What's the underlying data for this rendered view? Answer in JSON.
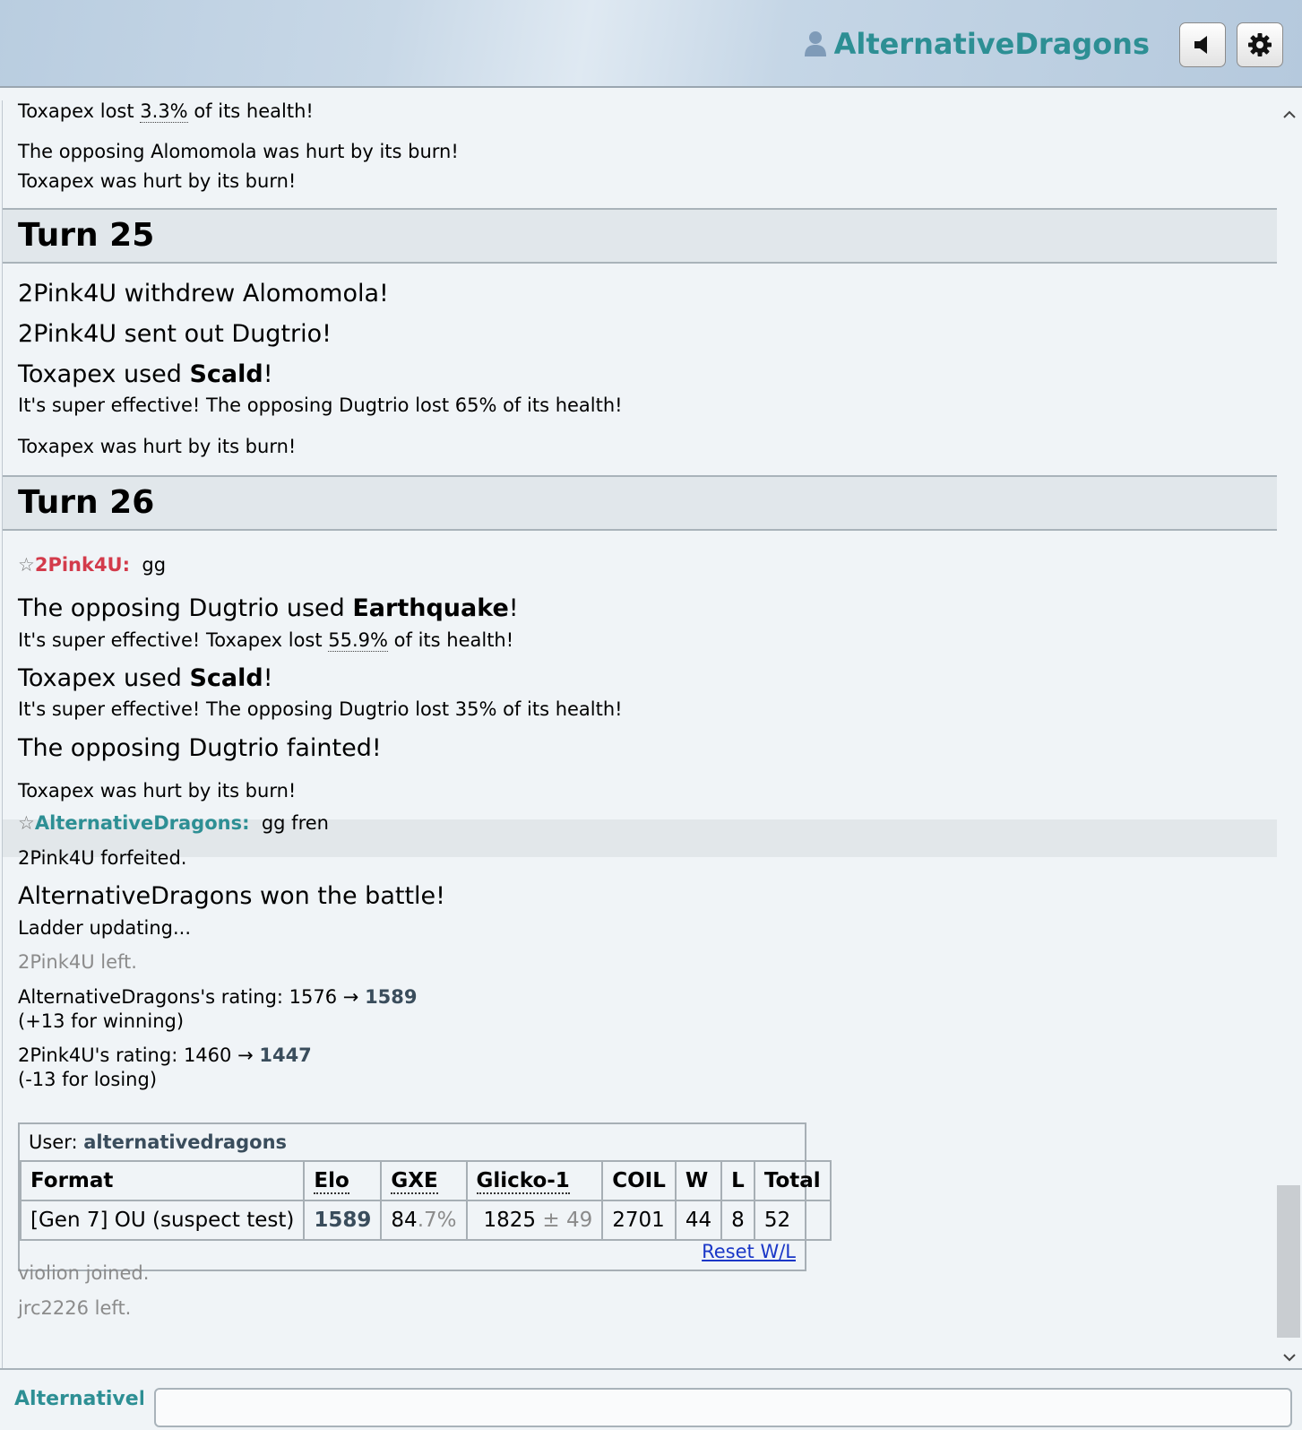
{
  "header": {
    "username": "AlternativeDragons",
    "sound_icon": "speaker-icon",
    "settings_icon": "gear-icon"
  },
  "log": {
    "top": {
      "l1_pre": "Toxapex lost ",
      "l1_pct": "3.3%",
      "l1_post": " of its health!",
      "l2": "The opposing Alomomola was hurt by its burn!",
      "l3": "Toxapex was hurt by its burn!"
    },
    "turn25": {
      "title": "Turn 25",
      "l1": "2Pink4U withdrew Alomomola!",
      "l2": "2Pink4U sent out Dugtrio!",
      "l3_pre": "Toxapex used ",
      "l3_move": "Scald",
      "l3_post": "!",
      "l4": "It's super effective! The opposing Dugtrio lost 65% of its health!",
      "l5": "Toxapex was hurt by its burn!"
    },
    "turn26": {
      "title": "Turn 26",
      "chat1_star": "☆",
      "chat1_name": "2Pink4U:",
      "chat1_msg": "gg",
      "l1_pre": "The opposing Dugtrio used ",
      "l1_move": "Earthquake",
      "l1_post": "!",
      "l2_pre": "It's super effective! Toxapex lost ",
      "l2_pct": "55.9%",
      "l2_post": " of its health!",
      "l3_pre": "Toxapex used ",
      "l3_move": "Scald",
      "l3_post": "!",
      "l4": "It's super effective! The opposing Dugtrio lost 35% of its health!",
      "l5": "The opposing Dugtrio fainted!",
      "l6": "Toxapex was hurt by its burn!",
      "chat2_star": "☆",
      "chat2_name": "AlternativeDragons:",
      "chat2_msg": "gg fren",
      "l7": "2Pink4U forfeited.",
      "l8": "AlternativeDragons won the battle!",
      "l9": "Ladder updating...",
      "l10": "2Pink4U left.",
      "r1_pre": "AlternativeDragons's rating: 1576 → ",
      "r1_new": "1589",
      "r1_note": "(+13 for winning)",
      "r2_pre": "2Pink4U's rating: 1460 → ",
      "r2_new": "1447",
      "r2_note": "(-13 for losing)",
      "j1": "violion joined.",
      "j2": "jrc2226 left."
    }
  },
  "ladder": {
    "user_label": "User: ",
    "user": "alternativedragons",
    "headers": [
      "Format",
      "Elo",
      "GXE",
      "Glicko-1",
      "COIL",
      "W",
      "L",
      "Total"
    ],
    "row": {
      "format": "[Gen 7] OU (suspect test)",
      "elo": "1589",
      "gxe_main": "84",
      "gxe_dec": ".7%",
      "glicko": "1825",
      "glicko_pm": " ± 49",
      "coil": "2701",
      "w": "44",
      "l": "8",
      "total": "52"
    },
    "reset": "Reset W/L"
  },
  "chatbox": {
    "label": "AlternativeDragons",
    "value": ""
  },
  "colors": {
    "teal": "#2d8f94",
    "pink": "#d33b4b",
    "link": "#1a37c7"
  }
}
